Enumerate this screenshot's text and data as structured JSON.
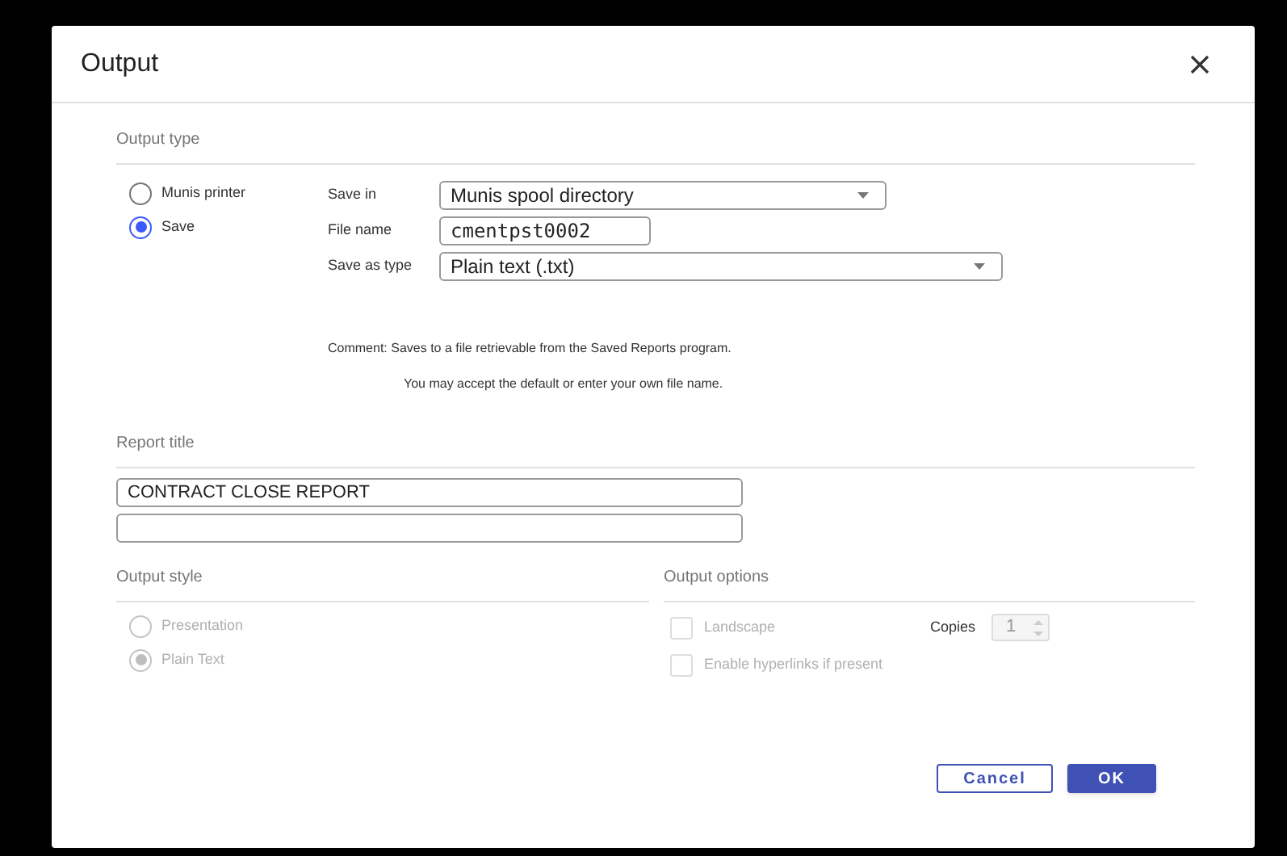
{
  "dialog": {
    "title": "Output"
  },
  "output_type": {
    "heading": "Output type",
    "options": [
      {
        "label": "Munis printer",
        "selected": false
      },
      {
        "label": "Save",
        "selected": true
      }
    ],
    "fields": [
      {
        "kind": "select",
        "label": "Save in",
        "value": "Munis spool directory"
      },
      {
        "kind": "text",
        "label": "File name",
        "value": "cmentpst0002"
      },
      {
        "kind": "select",
        "label": "Save as type",
        "value": "Plain text (.txt)"
      }
    ],
    "comment": [
      "Comment: Saves to a file retrievable from the Saved Reports program.",
      "You may accept the default or enter your own file name."
    ]
  },
  "report_title": {
    "heading": "Report title",
    "lines": [
      {
        "kind": "filled",
        "value": "CONTRACT CLOSE REPORT"
      },
      {
        "kind": "blank"
      }
    ]
  },
  "output_style": {
    "heading": "Output style",
    "options": [
      {
        "label": "Presentation",
        "selected": false,
        "disabled": true
      },
      {
        "label": "Plain Text",
        "selected": true,
        "disabled": true
      }
    ]
  },
  "output_options": {
    "heading": "Output options",
    "options": [
      {
        "label": "Landscape",
        "checked": false,
        "disabled": true
      },
      {
        "label": "Enable hyperlinks if present",
        "checked": false,
        "disabled": true
      }
    ],
    "copies": {
      "label": "Copies",
      "value": "1",
      "disabled": true
    }
  },
  "buttons": [
    {
      "kind": "secondary",
      "label": "Cancel"
    },
    {
      "kind": "primary",
      "label": "OK"
    }
  ]
}
